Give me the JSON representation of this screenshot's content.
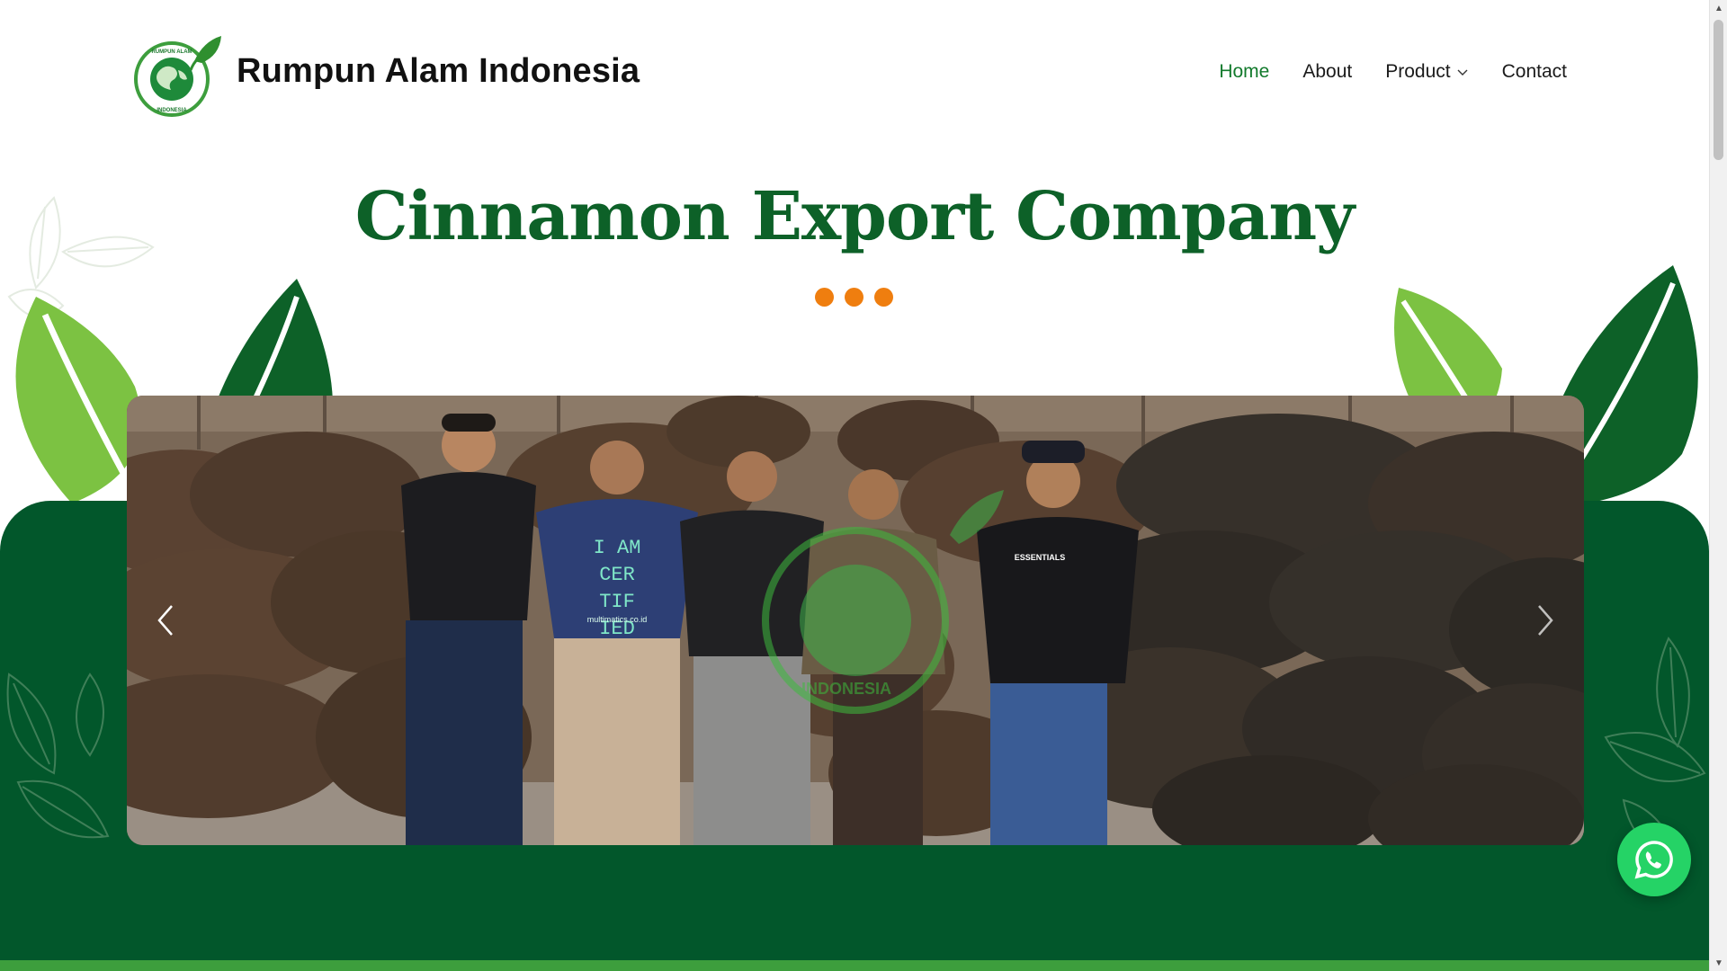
{
  "header": {
    "brand_name": "Rumpun Alam Indonesia",
    "logo_text_top": "RUMPUN ALAM",
    "logo_text_bottom": "INDONESIA",
    "nav": [
      {
        "label": "Home",
        "active": true
      },
      {
        "label": "About",
        "active": false
      },
      {
        "label": "Product",
        "active": false,
        "has_dropdown": true
      },
      {
        "label": "Contact",
        "active": false
      }
    ]
  },
  "hero": {
    "title": "Cinnamon Export Company",
    "dot_color": "#ef7e0f"
  },
  "slider": {
    "prev_icon": "chevron-left-icon",
    "next_icon": "chevron-right-icon",
    "shirt_texts": [
      "I AM",
      "CER",
      "TIF",
      "IED",
      "multimatics.co.id",
      "ESSENTIALS"
    ],
    "watermark_text": "INDONESIA"
  },
  "colors": {
    "brand_green": "#0d6128",
    "band_green": "#02572b",
    "nav_active": "#127a2c",
    "accent_orange": "#ef7e0f",
    "whatsapp": "#25d366"
  },
  "whatsapp_icon": "whatsapp-icon"
}
